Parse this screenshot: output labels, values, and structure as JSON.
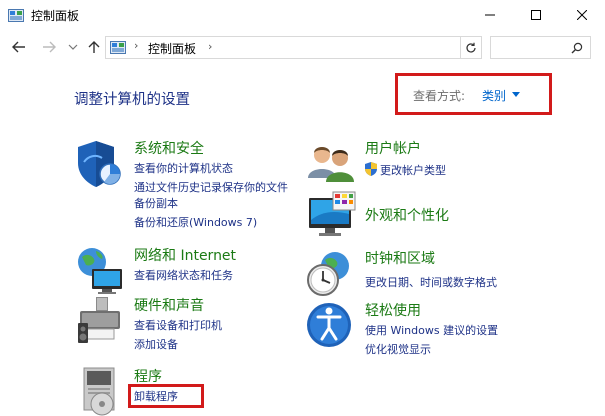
{
  "window": {
    "title": "控制面板"
  },
  "address": {
    "path": "控制面板",
    "separator": "›",
    "chevron": "›"
  },
  "search": {
    "placeholder": ""
  },
  "page": {
    "title": "调整计算机的设置"
  },
  "view": {
    "label": "查看方式:",
    "value": "类别"
  },
  "categories": [
    {
      "title": "系统和安全",
      "links": [
        "查看你的计算机状态",
        "通过文件历史记录保存你的文件",
        "备份副本",
        "备份和还原(Windows 7)"
      ]
    },
    {
      "title": "网络和 Internet",
      "links": [
        "查看网络状态和任务"
      ]
    },
    {
      "title": "硬件和声音",
      "links": [
        "查看设备和打印机",
        "添加设备"
      ]
    },
    {
      "title": "程序",
      "links": [
        "卸载程序"
      ]
    },
    {
      "title": "用户帐户",
      "links": [
        "更改帐户类型"
      ]
    },
    {
      "title": "外观和个性化",
      "links": []
    },
    {
      "title": "时钟和区域",
      "links": [
        "更改日期、时间或数字格式"
      ]
    },
    {
      "title": "轻松使用",
      "links": [
        "使用 Windows 建议的设置",
        "优化视觉显示"
      ]
    }
  ],
  "colors": {
    "accent": "#1e3287",
    "category_title": "#1b7a14",
    "highlight": "#d21a1a",
    "link_blue": "#0066cc"
  }
}
